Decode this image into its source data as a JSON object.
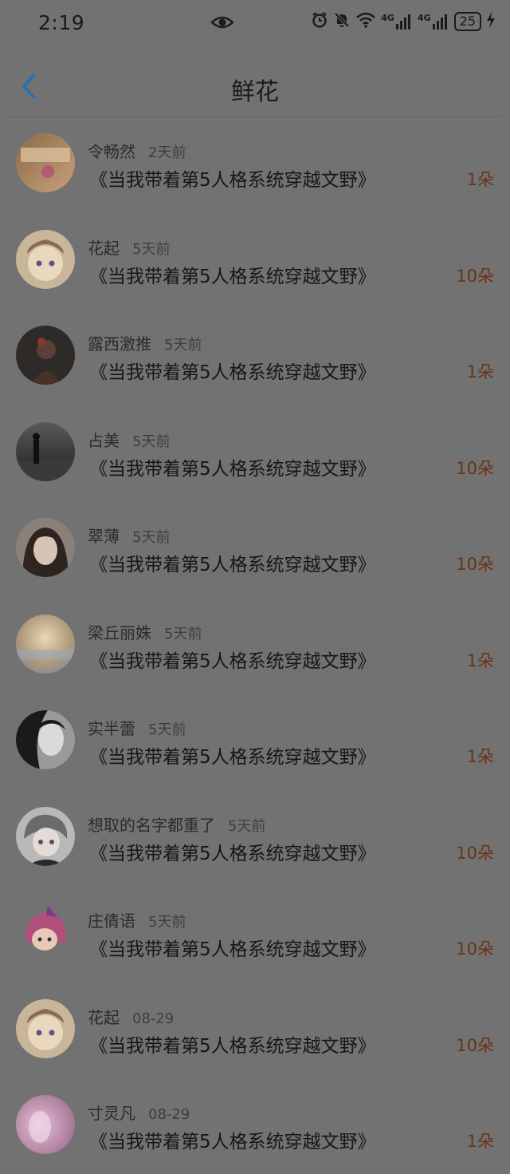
{
  "status_bar": {
    "time": "2:19",
    "battery": "25",
    "signal_label_1": "4G",
    "signal_label_2": "4G"
  },
  "header": {
    "title": "鲜花"
  },
  "items": [
    {
      "user": "令畅然",
      "time": "2天前",
      "book": "《当我带着第5人格系统穿越文野》",
      "count": "1朵",
      "avatar_colors": [
        "#8a6a4a",
        "#c9a07a"
      ]
    },
    {
      "user": "花起",
      "time": "5天前",
      "book": "《当我带着第5人格系统穿越文野》",
      "count": "10朵",
      "avatar_colors": [
        "#b09474",
        "#e9d3b1"
      ]
    },
    {
      "user": "露西激推",
      "time": "5天前",
      "book": "《当我带着第5人格系统穿越文野》",
      "count": "1朵",
      "avatar_colors": [
        "#2e2a28",
        "#6a4a3a"
      ]
    },
    {
      "user": "占美",
      "time": "5天前",
      "book": "《当我带着第5人格系统穿越文野》",
      "count": "10朵",
      "avatar_colors": [
        "#1e1e1e",
        "#7a7a7a"
      ]
    },
    {
      "user": "翠薄",
      "time": "5天前",
      "book": "《当我带着第5人格系统穿越文野》",
      "count": "10朵",
      "avatar_colors": [
        "#3a2f2a",
        "#9b8a80"
      ]
    },
    {
      "user": "梁丘丽姝",
      "time": "5天前",
      "book": "《当我带着第5人格系统穿越文野》",
      "count": "1朵",
      "avatar_colors": [
        "#9a7a5a",
        "#d8c2a0"
      ]
    },
    {
      "user": "实半蕾",
      "time": "5天前",
      "book": "《当我带着第5人格系统穿越文野》",
      "count": "1朵",
      "avatar_colors": [
        "#1a1a1a",
        "#8c8c8c"
      ]
    },
    {
      "user": "想取的名字都重了",
      "time": "5天前",
      "book": "《当我带着第5人格系统穿越文野》",
      "count": "10朵",
      "avatar_colors": [
        "#3a3a3a",
        "#9a9a9a"
      ]
    },
    {
      "user": "庄倩语",
      "time": "5天前",
      "book": "《当我带着第5人格系统穿越文野》",
      "count": "10朵",
      "avatar_colors": [
        "#7a3a5a",
        "#c07a9a"
      ]
    },
    {
      "user": "花起",
      "time": "08-29",
      "book": "《当我带着第5人格系统穿越文野》",
      "count": "10朵",
      "avatar_colors": [
        "#b09474",
        "#e9d3b1"
      ]
    },
    {
      "user": "寸灵凡",
      "time": "08-29",
      "book": "《当我带着第5人格系统穿越文野》",
      "count": "1朵",
      "avatar_colors": [
        "#9a6a8a",
        "#dab0c8"
      ]
    }
  ],
  "colors": {
    "accent": "#2a6fb0",
    "count": "#6a3415"
  }
}
